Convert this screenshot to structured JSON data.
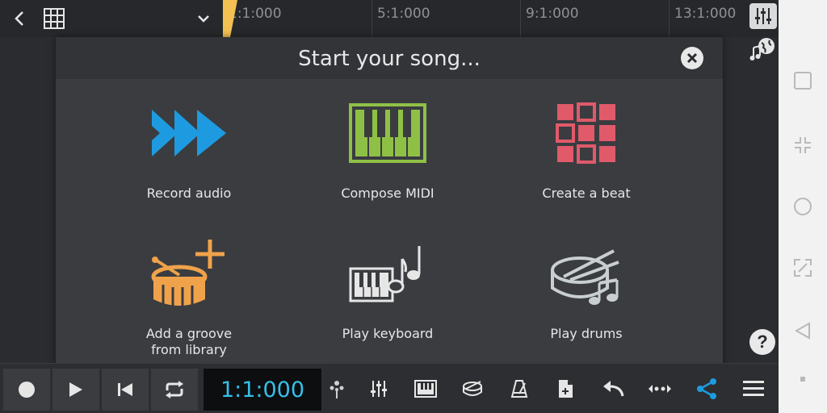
{
  "timeline": {
    "markers": [
      "1:1:000",
      "5:1:000",
      "9:1:000",
      "13:1:000"
    ]
  },
  "modal": {
    "title": "Start your song...",
    "tiles": [
      {
        "label": "Record audio",
        "icon": "record-audio-icon"
      },
      {
        "label": "Compose MIDI",
        "icon": "compose-midi-icon"
      },
      {
        "label": "Create a beat",
        "icon": "create-beat-icon"
      },
      {
        "label_line1": "Add a groove",
        "label_line2": "from library",
        "icon": "add-groove-icon"
      },
      {
        "label": "Play keyboard",
        "icon": "play-keyboard-icon"
      },
      {
        "label": "Play drums",
        "icon": "play-drums-icon"
      }
    ]
  },
  "transport": {
    "time": "1:1:000"
  },
  "help": {
    "label": "?"
  },
  "colors": {
    "accent_blue": "#1e9be0",
    "midi_green": "#8fc046",
    "beat_red": "#e05a6a",
    "groove_orange": "#f0a24a",
    "time_cyan": "#35c0e8",
    "playhead_yellow": "#f2c152"
  }
}
